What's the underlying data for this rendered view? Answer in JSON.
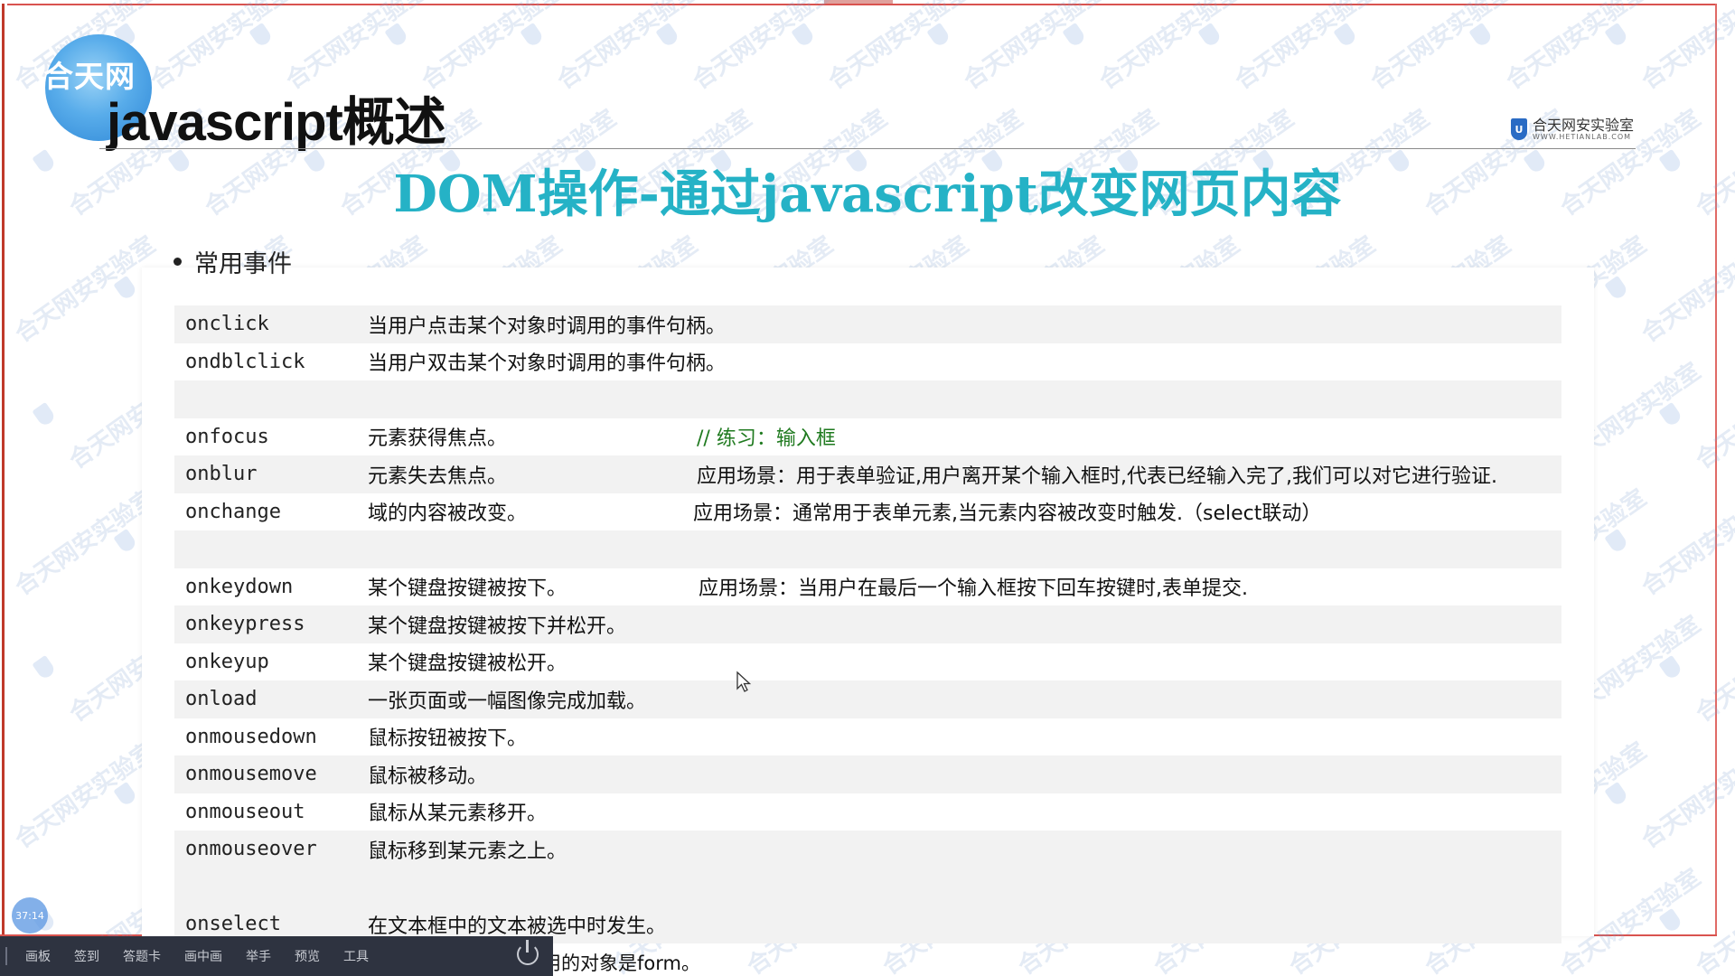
{
  "header": {
    "logo_text": "合天网",
    "section_title": "javascript概述",
    "brand_name": "合天网安实验室",
    "brand_url": "WWW.HETIANLAB.COM",
    "watermark_text": "合天网安实验室"
  },
  "slide": {
    "title": "DOM操作-通过javascript改变网页内容",
    "bullet": "常用事件"
  },
  "events": [
    {
      "name": "onclick",
      "desc": "当用户点击某个对象时调用的事件句柄。",
      "note": ""
    },
    {
      "name": "ondblclick",
      "desc": "当用户双击某个对象时调用的事件句柄。",
      "note": ""
    },
    {
      "name": "",
      "desc": "",
      "note": ""
    },
    {
      "name": "onfocus",
      "desc": "元素获得焦点。",
      "note": "// 练习：输入框"
    },
    {
      "name": "onblur",
      "desc": "元素失去焦点。",
      "note": "应用场景：用于表单验证,用户离开某个输入框时,代表已经输入完了,我们可以对它进行验证."
    },
    {
      "name": "onchange",
      "desc": "域的内容被改变。",
      "note": "应用场景：通常用于表单元素,当元素内容被改变时触发.（select联动）"
    },
    {
      "name": "",
      "desc": "",
      "note": ""
    },
    {
      "name": "onkeydown",
      "desc": "某个键盘按键被按下。",
      "note": "应用场景：当用户在最后一个输入框按下回车按键时,表单提交."
    },
    {
      "name": "onkeypress",
      "desc": "某个键盘按键被按下并松开。",
      "note": ""
    },
    {
      "name": "onkeyup",
      "desc": "某个键盘按键被松开。",
      "note": ""
    },
    {
      "name": "onload",
      "desc": "一张页面或一幅图像完成加载。",
      "note": ""
    },
    {
      "name": "onmousedown",
      "desc": "鼠标按钮被按下。",
      "note": ""
    },
    {
      "name": "onmousemove",
      "desc": "鼠标被移动。",
      "note": ""
    },
    {
      "name": "onmouseout",
      "desc": "鼠标从某元素移开。",
      "note": ""
    },
    {
      "name": "onmouseover",
      "desc": "鼠标移到某元素之上。",
      "note": ""
    },
    {
      "name": "",
      "desc": "",
      "note": ""
    },
    {
      "name": "onselect",
      "desc": "在文本框中的文本被选中时发生。",
      "note": ""
    }
  ],
  "partial_last_line": "用的对象是form。",
  "toolbar": {
    "items": [
      "画板",
      "签到",
      "答题卡",
      "画中画",
      "举手",
      "预览",
      "工具"
    ]
  },
  "timer": "37:14"
}
